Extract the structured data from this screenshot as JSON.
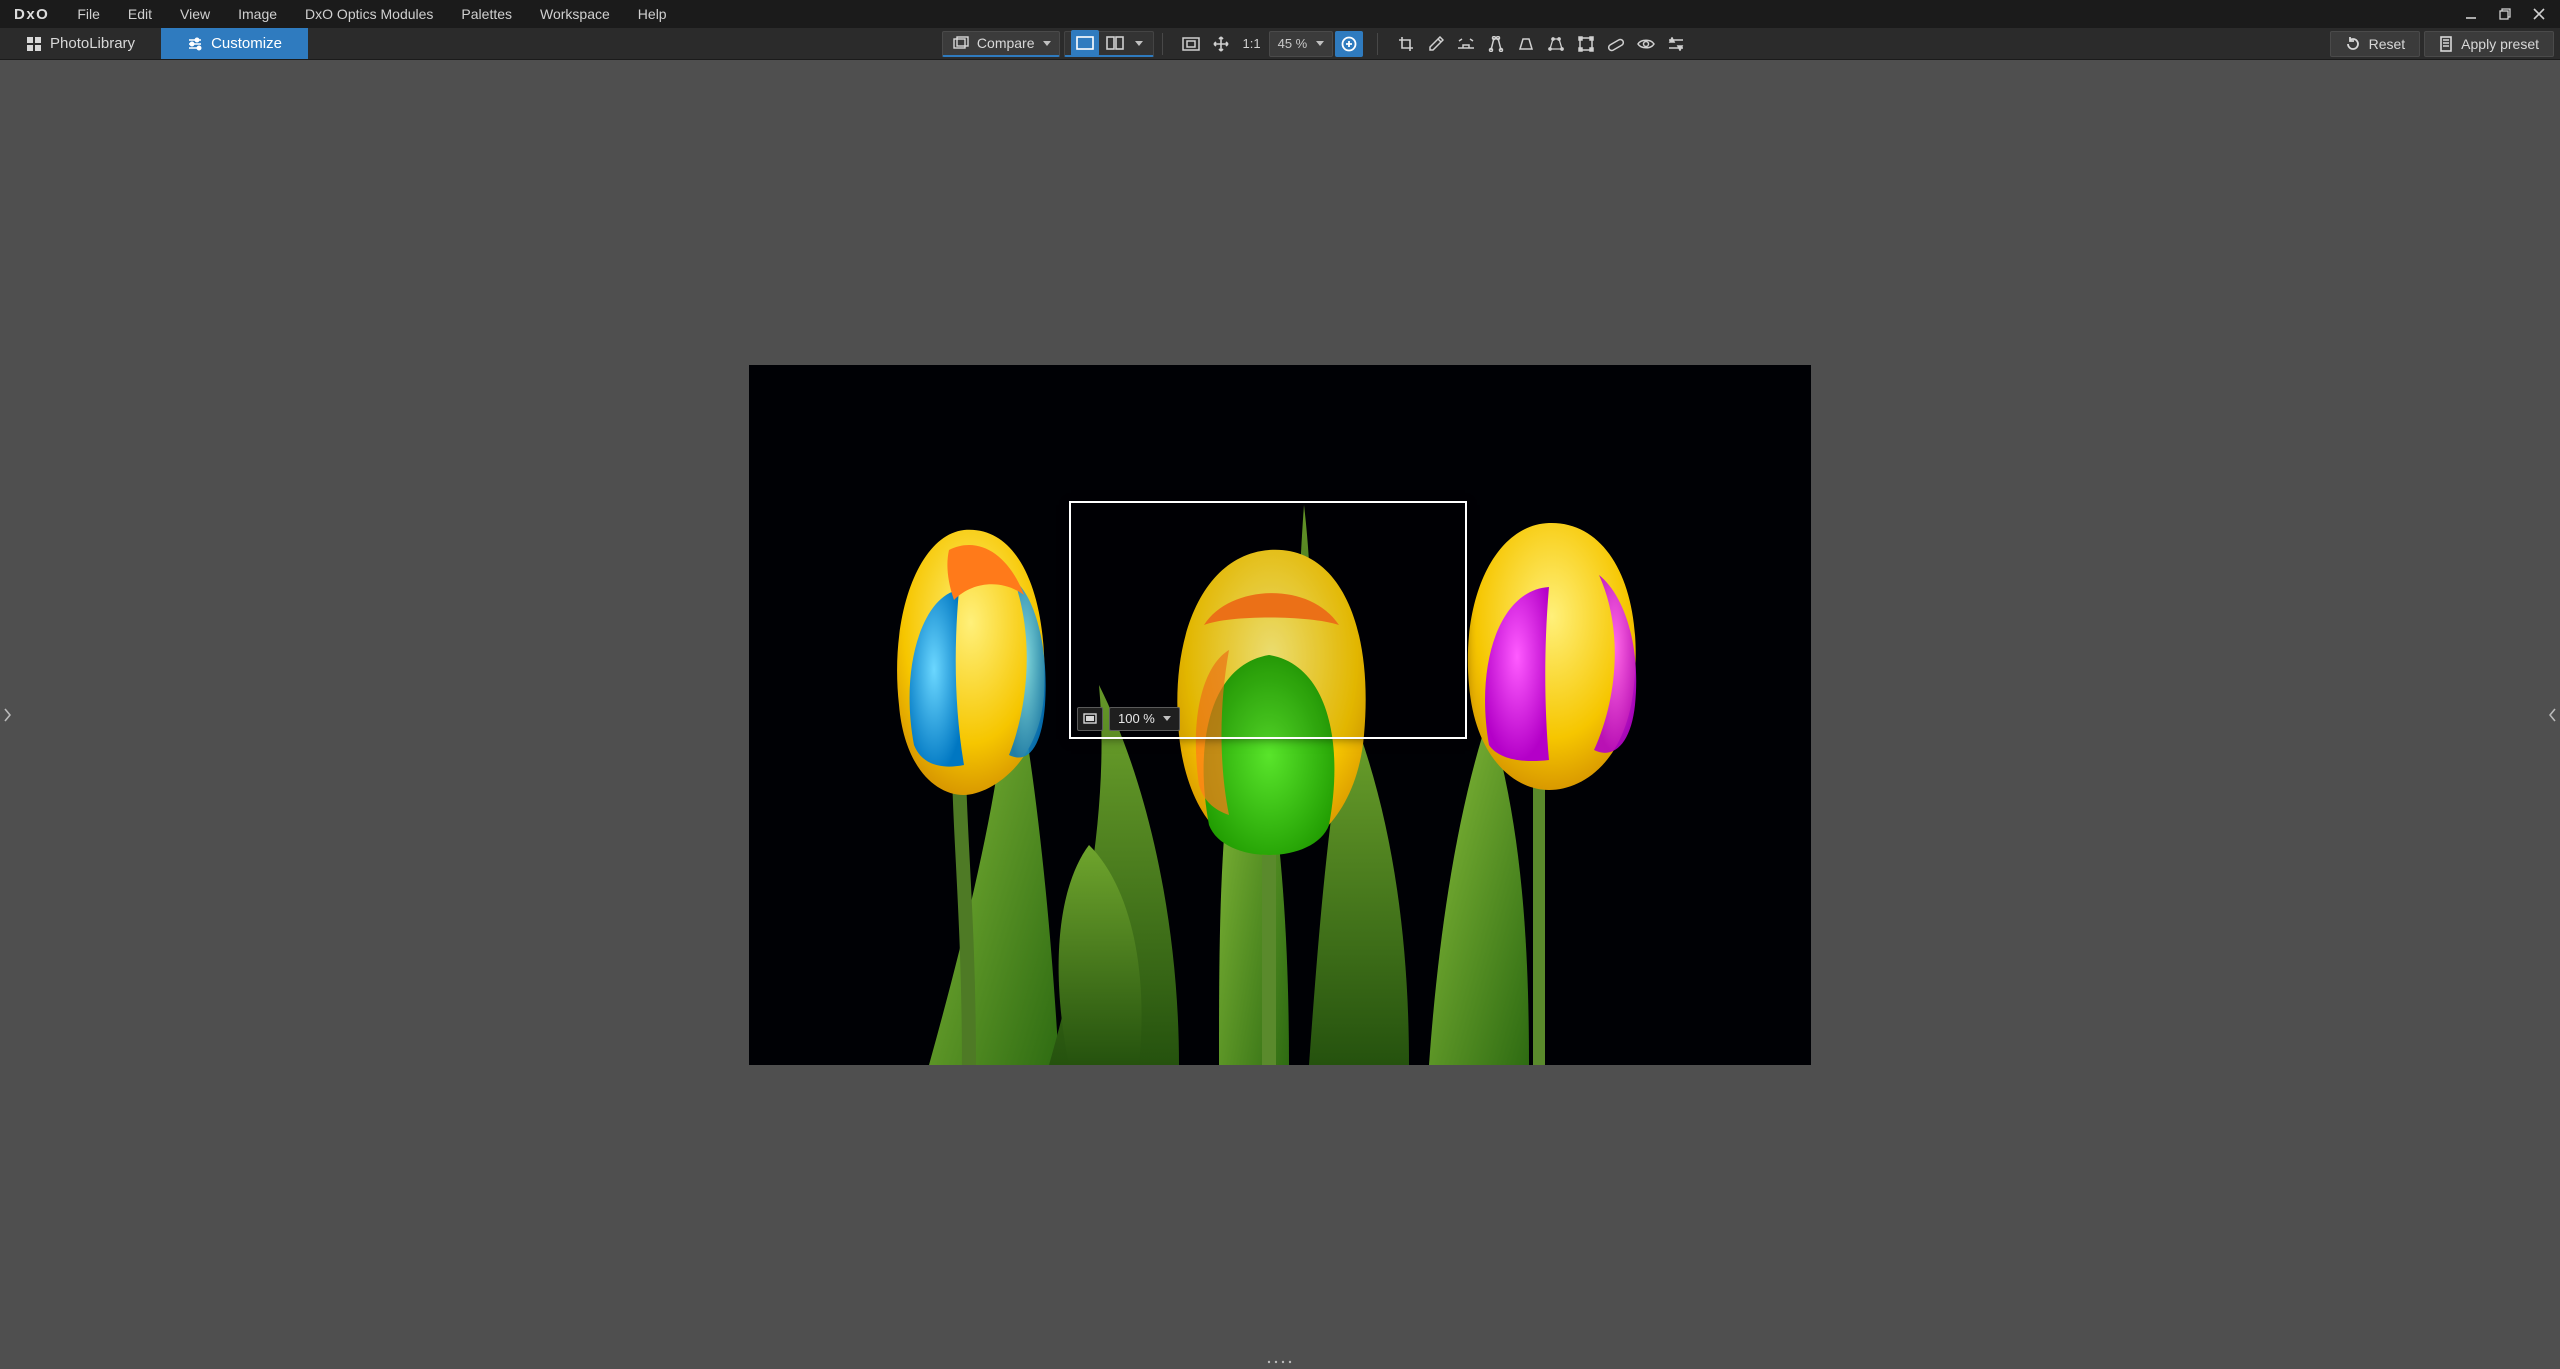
{
  "logo": "DxO",
  "menu": [
    "File",
    "Edit",
    "View",
    "Image",
    "DxO Optics Modules",
    "Palettes",
    "Workspace",
    "Help"
  ],
  "modes": {
    "photolibrary": "PhotoLibrary",
    "customize": "Customize"
  },
  "compare_label": "Compare",
  "zoom_label": "1:1",
  "zoom_percent": "45 %",
  "reset_label": "Reset",
  "apply_label": "Apply preset",
  "loupe_zoom": "100 %"
}
